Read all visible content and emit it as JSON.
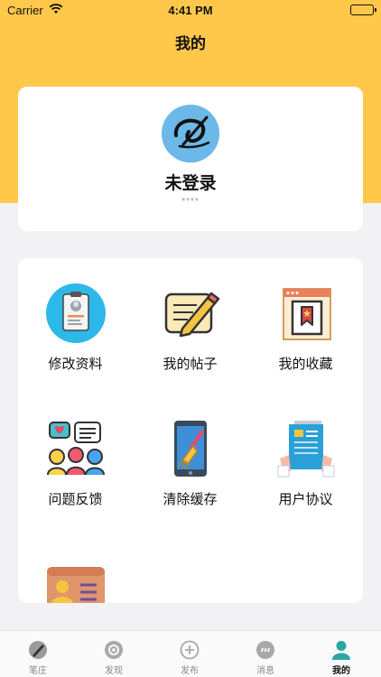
{
  "status_bar": {
    "carrier": "Carrier",
    "time": "4:41 PM"
  },
  "nav": {
    "title": "我的"
  },
  "profile": {
    "name": "未登录",
    "subtitle": "****"
  },
  "menu": [
    {
      "label": "修改资料",
      "icon": "edit-profile-icon"
    },
    {
      "label": "我的帖子",
      "icon": "my-posts-icon"
    },
    {
      "label": "我的收藏",
      "icon": "favorites-icon"
    },
    {
      "label": "问题反馈",
      "icon": "feedback-icon"
    },
    {
      "label": "清除缓存",
      "icon": "clear-cache-icon"
    },
    {
      "label": "用户协议",
      "icon": "user-agreement-icon"
    },
    {
      "label": "",
      "icon": "id-card-icon"
    }
  ],
  "tabs": [
    {
      "label": "笔庄",
      "icon": "pen-icon",
      "active": false
    },
    {
      "label": "发现",
      "icon": "discover-icon",
      "active": false
    },
    {
      "label": "发布",
      "icon": "add-icon",
      "active": false
    },
    {
      "label": "消息",
      "icon": "message-icon",
      "active": false
    },
    {
      "label": "我的",
      "icon": "profile-icon",
      "active": true
    }
  ],
  "colors": {
    "header": "#ffc84a",
    "background": "#f2f2f4",
    "active_tab": "#2aa6a6"
  }
}
